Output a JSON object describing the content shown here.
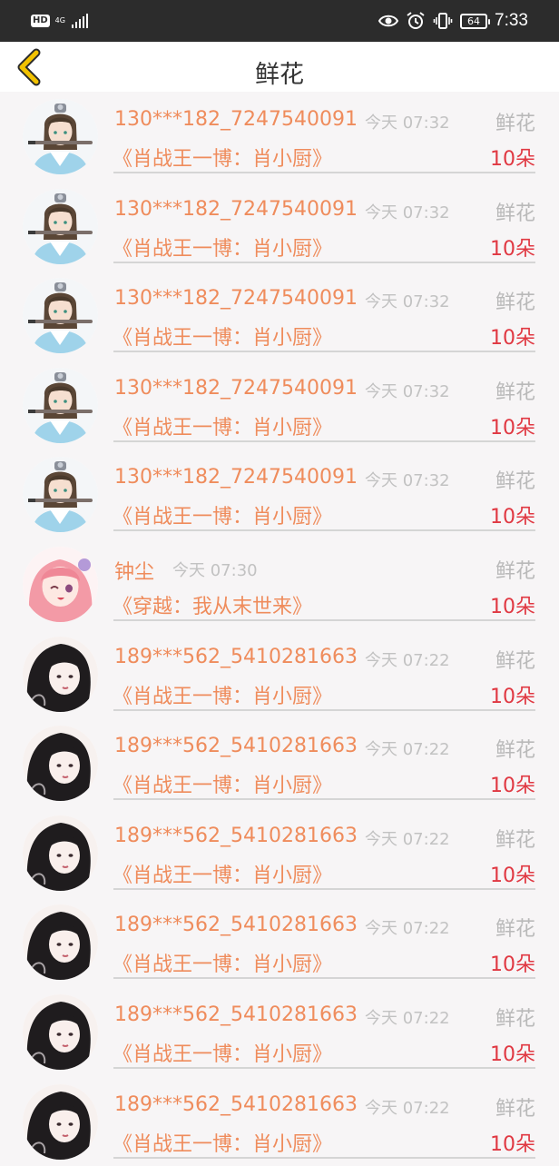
{
  "status_bar": {
    "hd": "HD",
    "network": "4G",
    "battery": "64",
    "time": "7:33"
  },
  "header": {
    "title": "鲜花"
  },
  "items": [
    {
      "avatar": "swordsman",
      "name": "130***182_7247540091",
      "time": "今天 07:32",
      "type": "鲜花",
      "book": "《肖战王一博：肖小厨》",
      "count": "10朵"
    },
    {
      "avatar": "swordsman",
      "name": "130***182_7247540091",
      "time": "今天 07:32",
      "type": "鲜花",
      "book": "《肖战王一博：肖小厨》",
      "count": "10朵"
    },
    {
      "avatar": "swordsman",
      "name": "130***182_7247540091",
      "time": "今天 07:32",
      "type": "鲜花",
      "book": "《肖战王一博：肖小厨》",
      "count": "10朵"
    },
    {
      "avatar": "swordsman",
      "name": "130***182_7247540091",
      "time": "今天 07:32",
      "type": "鲜花",
      "book": "《肖战王一博：肖小厨》",
      "count": "10朵"
    },
    {
      "avatar": "swordsman",
      "name": "130***182_7247540091",
      "time": "今天 07:32",
      "type": "鲜花",
      "book": "《肖战王一博：肖小厨》",
      "count": "10朵"
    },
    {
      "avatar": "pink-anime-girl",
      "name": "钟尘",
      "time": "今天 07:30",
      "type": "鲜花",
      "book": "《穿越：我从末世来》",
      "count": "10朵"
    },
    {
      "avatar": "dark-hair-girl",
      "name": "189***562_5410281663",
      "time": "今天 07:22",
      "type": "鲜花",
      "book": "《肖战王一博：肖小厨》",
      "count": "10朵"
    },
    {
      "avatar": "dark-hair-girl",
      "name": "189***562_5410281663",
      "time": "今天 07:22",
      "type": "鲜花",
      "book": "《肖战王一博：肖小厨》",
      "count": "10朵"
    },
    {
      "avatar": "dark-hair-girl",
      "name": "189***562_5410281663",
      "time": "今天 07:22",
      "type": "鲜花",
      "book": "《肖战王一博：肖小厨》",
      "count": "10朵"
    },
    {
      "avatar": "dark-hair-girl",
      "name": "189***562_5410281663",
      "time": "今天 07:22",
      "type": "鲜花",
      "book": "《肖战王一博：肖小厨》",
      "count": "10朵"
    },
    {
      "avatar": "dark-hair-girl",
      "name": "189***562_5410281663",
      "time": "今天 07:22",
      "type": "鲜花",
      "book": "《肖战王一博：肖小厨》",
      "count": "10朵"
    },
    {
      "avatar": "dark-hair-girl",
      "name": "189***562_5410281663",
      "time": "今天 07:22",
      "type": "鲜花",
      "book": "《肖战王一博：肖小厨》",
      "count": "10朵"
    }
  ],
  "colors": {
    "name": "#ef8c5c",
    "count": "#e03842",
    "back_arrow": "#f2c200",
    "muted": "#c2c2c2"
  }
}
